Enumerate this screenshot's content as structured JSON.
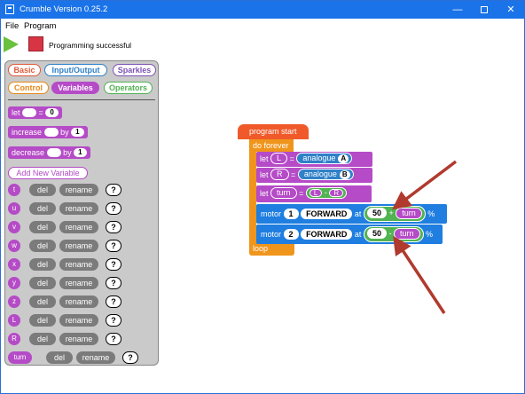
{
  "window": {
    "title": "Crumble Version 0.25.2"
  },
  "titlebar": {
    "minimize": "—",
    "close": "✕"
  },
  "menu": {
    "file": "File",
    "program": "Program"
  },
  "toolbar": {
    "status": "Programming successful"
  },
  "palette": {
    "categories": {
      "basic": "Basic",
      "io": "Input/Output",
      "sparkles": "Sparkles",
      "control": "Control",
      "variables": "Variables",
      "operators": "Operators"
    },
    "let_block": {
      "label": "let",
      "eq": "=",
      "value": "0"
    },
    "increase_block": {
      "label": "increase",
      "by": "by",
      "value": "1"
    },
    "decrease_block": {
      "label": "decrease",
      "by": "by",
      "value": "1"
    },
    "add_variable": "Add New Variable",
    "del_label": "del",
    "rename_label": "rename",
    "help_label": "?",
    "variables": [
      "t",
      "u",
      "v",
      "w",
      "x",
      "y",
      "z",
      "L",
      "R",
      "turn"
    ]
  },
  "program": {
    "start": "program start",
    "forever": "do forever",
    "loop": "loop",
    "let1": {
      "kw": "let",
      "var": "L",
      "eq": "=",
      "fn": "analogue",
      "pin": "A"
    },
    "let2": {
      "kw": "let",
      "var": "R",
      "eq": "=",
      "fn": "analogue",
      "pin": "B"
    },
    "let3": {
      "kw": "let",
      "var": "turn",
      "eq": "=",
      "a": "L",
      "op": "-",
      "b": "R"
    },
    "motor1": {
      "kw": "motor",
      "num": "1",
      "dir": "FORWARD",
      "at": "at",
      "val": "50",
      "op": "+",
      "var": "turn",
      "pct": "%"
    },
    "motor2": {
      "kw": "motor",
      "num": "2",
      "dir": "FORWARD",
      "at": "at",
      "val": "50",
      "op": "-",
      "var": "turn",
      "pct": "%"
    }
  },
  "colors": {
    "titlebar": "#1a73e8",
    "variables": "#b54bc7",
    "motor": "#1f7ee0",
    "operator": "#52b352",
    "control": "#f0951c",
    "start": "#f05a2a",
    "arrow": "#b03a2e"
  }
}
